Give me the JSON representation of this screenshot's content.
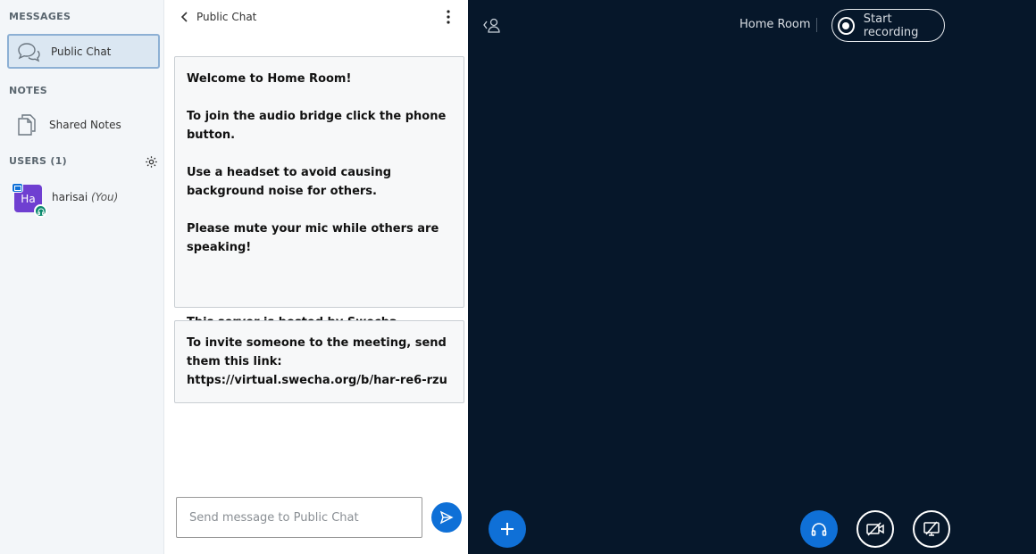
{
  "sidebar": {
    "messages_title": "MESSAGES",
    "public_chat_label": "Public Chat",
    "notes_title": "NOTES",
    "shared_notes_label": "Shared Notes",
    "users_title": "USERS (1)",
    "user": {
      "initials": "Ha",
      "name": "harisai",
      "you": "(You)"
    }
  },
  "chat": {
    "title": "Public Chat",
    "welcome": {
      "line1_prefix": "Welcome to ",
      "line1_room": "Home Room",
      "line1_suffix": "!",
      "line2": "To join the audio bridge click the phone button.",
      "line3": "Use a headset to avoid causing background noise for others.",
      "line4": "Please mute your mic while others are speaking!",
      "line5_prefix": "This server is hosted by ",
      "line5_link": "Swecha",
      "line5_suffix": "."
    },
    "invite": "To invite someone to the meeting, send them this link: https://virtual.swecha.org/b/har-re6-rzu",
    "compose_placeholder": "Send message to Public Chat"
  },
  "main": {
    "room_name": "Home Room",
    "record_label": "Start recording"
  },
  "colors": {
    "accent": "#0f70d7",
    "main_bg": "#06172a",
    "sidebar_bg": "#f3f6f9",
    "avatar": "#6f3fd1"
  }
}
